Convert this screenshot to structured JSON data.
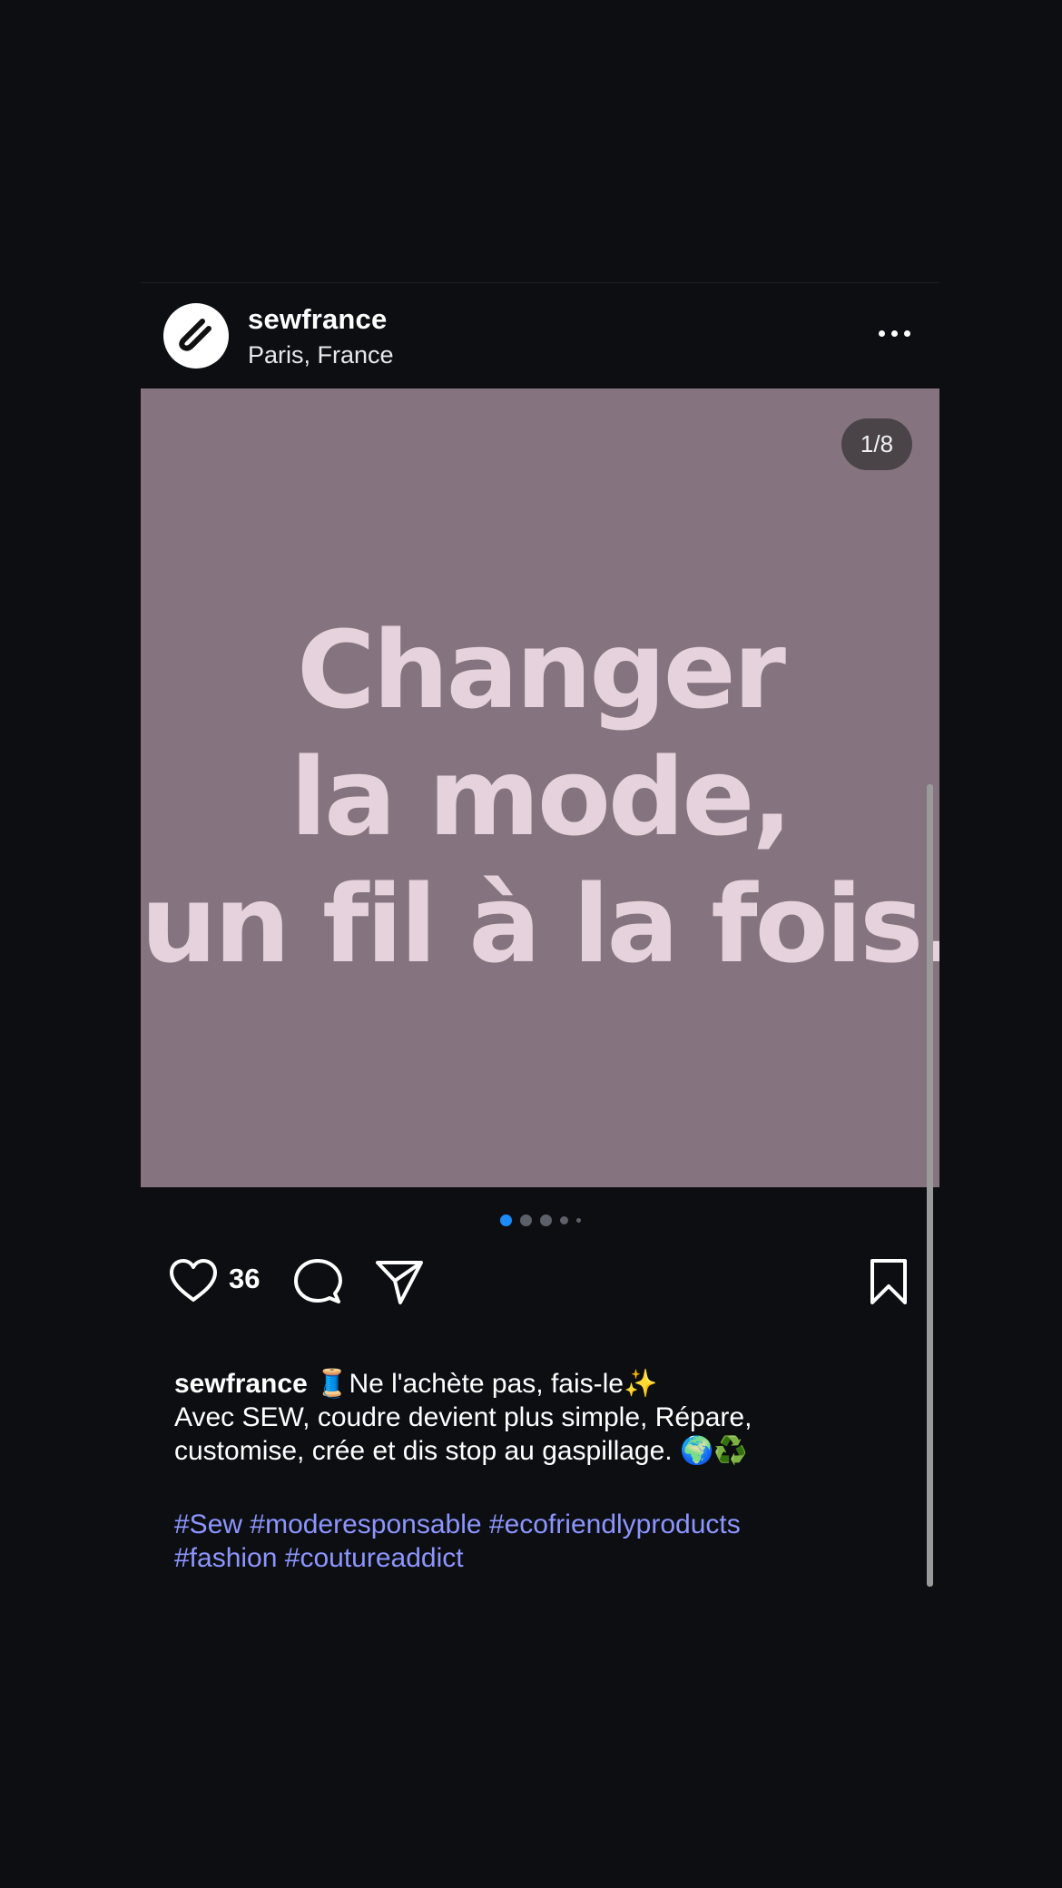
{
  "post": {
    "username": "sewfrance",
    "location": "Paris, France",
    "counter": "1/8",
    "media_lines": [
      "Changer",
      "la mode,",
      "un fil à la fois."
    ],
    "likes": "36",
    "caption": {
      "username": "sewfrance",
      "line1": " 🧵Ne l'achète pas, fais-le✨",
      "line2": "Avec SEW, coudre devient plus simple, Répare,",
      "line3": "customise, crée et dis stop au gaspillage. 🌍♻️"
    },
    "hashtags": [
      "#Sew",
      "#moderesponsable",
      "#ecofriendlyproducts",
      "#fashion",
      "#coutureaddict"
    ]
  },
  "carousel": {
    "active_index": 0,
    "visible_dots": 5
  },
  "colors": {
    "background": "#0c0e12",
    "media_bg": "#85747f",
    "media_text": "#e6d2dc",
    "active_dot": "#1d8cf8",
    "hashtag": "#8d95ff"
  },
  "icons": {
    "more": "more-horizontal-icon",
    "like": "heart-icon",
    "comment": "comment-icon",
    "share": "paper-plane-icon",
    "save": "bookmark-icon"
  }
}
